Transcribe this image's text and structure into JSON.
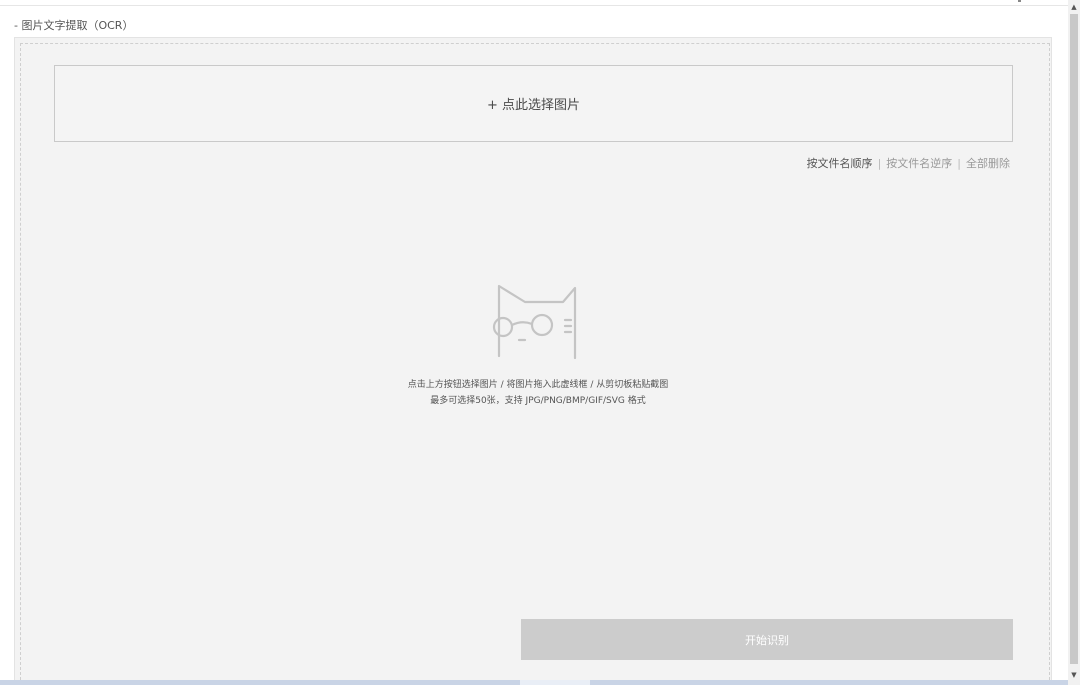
{
  "section": {
    "title": "- 图片文字提取（OCR）"
  },
  "uploader": {
    "select_label": "+ 点此选择图片"
  },
  "sort": {
    "by_name_asc": "按文件名顺序",
    "by_name_desc": "按文件名逆序",
    "delete_all": "全部删除",
    "separator": "|"
  },
  "empty_state": {
    "icon": "cat-with-glasses-icon",
    "hint_line1": "点击上方按钮选择图片 / 将图片拖入此虚线框 / 从剪切板粘贴截图",
    "hint_line2": "最多可选择50张，支持 JPG/PNG/BMP/GIF/SVG 格式"
  },
  "actions": {
    "start_label": "开始识别"
  },
  "scrollbar": {
    "up_arrow": "▲",
    "down_arrow": "▼"
  },
  "colors": {
    "panel_bg": "#f3f3f3",
    "button_disabled_bg": "#cccccc",
    "text_muted": "#999999"
  }
}
